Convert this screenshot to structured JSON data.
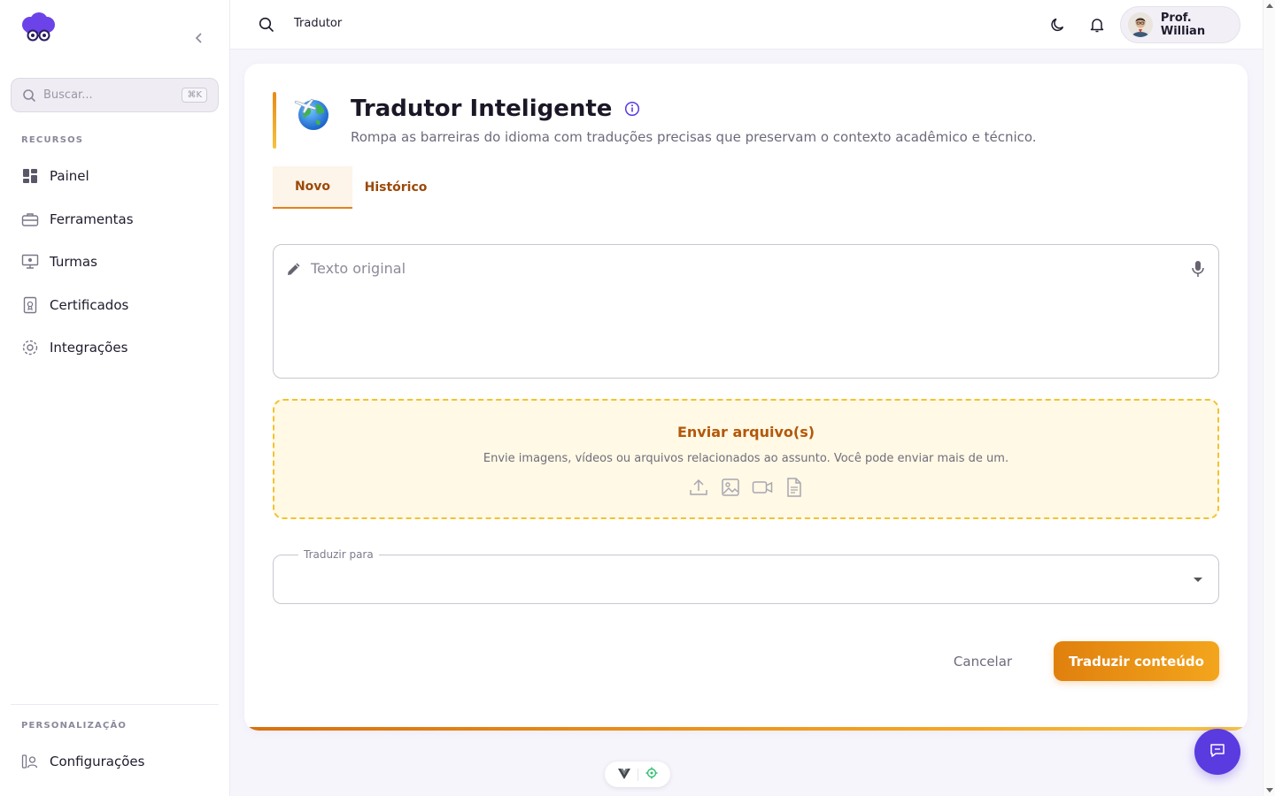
{
  "sidebar": {
    "search_placeholder": "Buscar...",
    "search_shortcut": "⌘K",
    "sections": {
      "resources": "RECURSOS",
      "personalization": "PERSONALIZAÇÃO"
    },
    "items": [
      {
        "label": "Painel",
        "icon": "dashboard-icon"
      },
      {
        "label": "Ferramentas",
        "icon": "toolbox-icon"
      },
      {
        "label": "Turmas",
        "icon": "classroom-icon"
      },
      {
        "label": "Certificados",
        "icon": "certificate-icon"
      },
      {
        "label": "Integrações",
        "icon": "integrations-gear-icon"
      }
    ],
    "settings_label": "Configurações"
  },
  "topbar": {
    "breadcrumb": "Tradutor",
    "user_name": "Prof. Willian"
  },
  "main": {
    "title": "Tradutor Inteligente",
    "subtitle": "Rompa as barreiras do idioma com traduções precisas que preservam o contexto acadêmico e técnico.",
    "tabs": [
      {
        "label": "Novo",
        "active": true
      },
      {
        "label": "Histórico",
        "active": false
      }
    ],
    "text_input": {
      "placeholder": "Texto original",
      "value": ""
    },
    "upload": {
      "title": "Enviar arquivo(s)",
      "description": "Envie imagens, vídeos ou arquivos relacionados ao assunto. Você pode enviar mais de um."
    },
    "target_language": {
      "label": "Traduzir para",
      "value": ""
    },
    "actions": {
      "cancel": "Cancelar",
      "submit": "Traduzir conteúdo"
    }
  },
  "colors": {
    "accent_orange": "#e3821c",
    "brand_purple": "#5a3be0",
    "dropzone_border": "#f2c230"
  }
}
